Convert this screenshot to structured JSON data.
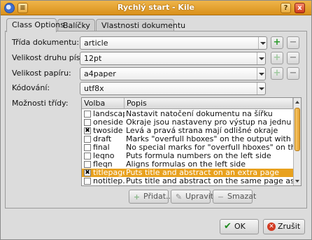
{
  "window": {
    "title": "Rychlý start - Kile",
    "help": "?",
    "close": "x",
    "menu": "≡"
  },
  "tabs": [
    {
      "label": "Class Options",
      "active": true
    },
    {
      "label": "Balíčky",
      "active": false
    },
    {
      "label": "Vlastnosti dokumentu",
      "active": false
    }
  ],
  "form": {
    "doc_class": {
      "label": "Třída dokumentu:",
      "value": "article"
    },
    "font_size": {
      "label": "Velikost druhu písma:",
      "value": "12pt"
    },
    "paper_size": {
      "label": "Velikost papíru:",
      "value": "a4paper"
    },
    "encoding": {
      "label": "Kódování:",
      "value": "utf8x"
    },
    "class_options_label": "Možnosti třídy:"
  },
  "options_table": {
    "columns": [
      "Volba",
      "Popis"
    ],
    "rows": [
      {
        "option": "landscape",
        "description": "Nastavit natočení dokumentu na šířku",
        "checked": false,
        "selected": false
      },
      {
        "option": "oneside",
        "description": "Okraje jsou nastaveny pro výstup na jednu stranu [d...",
        "checked": false,
        "selected": false
      },
      {
        "option": "twoside",
        "description": "Levá a pravá strana mají odlišné okraje",
        "checked": true,
        "selected": false
      },
      {
        "option": "draft",
        "description": "Marks \"overfull hboxes\" on the output with black boxes",
        "checked": false,
        "selected": false
      },
      {
        "option": "final",
        "description": "No special marks for \"overfull hboxes\" on the output...",
        "checked": false,
        "selected": false
      },
      {
        "option": "leqno",
        "description": "Puts formula numbers on the left side",
        "checked": false,
        "selected": false
      },
      {
        "option": "fleqn",
        "description": "Aligns formulas on the left side",
        "checked": false,
        "selected": false
      },
      {
        "option": "titlepage",
        "description": "Puts title and abstract on an extra page",
        "checked": true,
        "selected": true
      },
      {
        "option": "notitlep...",
        "description": "Puts title and abstract on the same page as the text",
        "checked": false,
        "selected": false
      }
    ]
  },
  "list_buttons": {
    "add": "Přidat...",
    "edit": "Upravit...",
    "delete": "Smazat"
  },
  "dialog_buttons": {
    "ok": "OK",
    "cancel": "Zrušit"
  },
  "icons": {
    "plus": "+",
    "minus": "−",
    "ok_check": "✔",
    "cancel_x": "✕",
    "edit": "✎",
    "check_mark": "✖"
  }
}
